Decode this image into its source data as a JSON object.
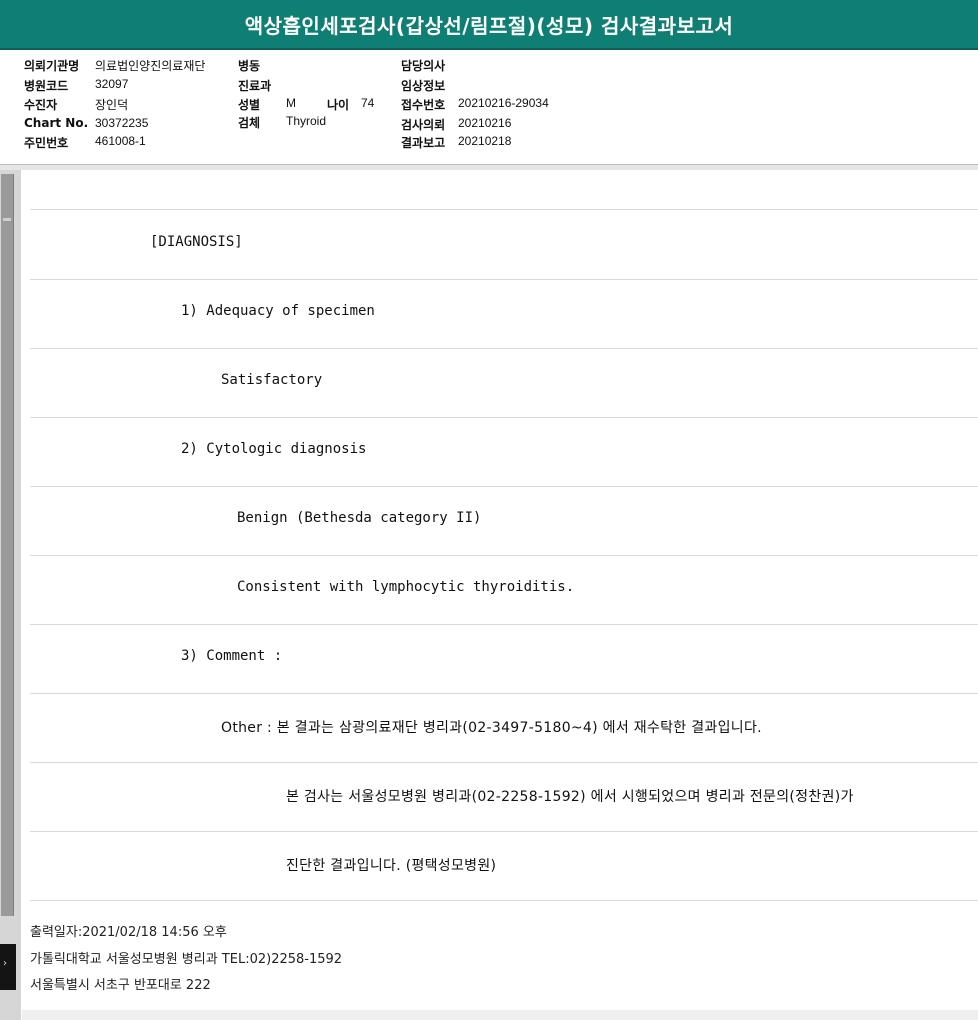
{
  "report": {
    "title": "액상흡인세포검사(갑상선/림프절)(성모) 검사결과보고서"
  },
  "header": {
    "institution_label": "의뢰기관명",
    "institution_value": "의료법인양진의료재단",
    "hospital_code_label": "병원코드",
    "hospital_code_value": "32097",
    "patient_label": "수진자",
    "patient_value": "장인덕",
    "chart_label": "Chart No.",
    "chart_value": "30372235",
    "id_label": "주민번호",
    "id_value": "461008-1",
    "ward_label": "병동",
    "ward_value": "",
    "dept_label": "진료과",
    "dept_value": "",
    "sex_label": "성별",
    "sex_value": "M",
    "age_label": "나이",
    "age_value": "74",
    "specimen_label": "검체",
    "specimen_value": "Thyroid",
    "doctor_label": "담당의사",
    "doctor_value": "",
    "clinical_label": "임상정보",
    "clinical_value": "",
    "receipt_label": "접수번호",
    "receipt_value": "20210216-29034",
    "request_label": "검사의뢰",
    "request_value": "20210216",
    "result_label": "결과보고",
    "result_value": "20210218"
  },
  "diagnosis_lines": [
    "",
    "[DIAGNOSIS]",
    "1) Adequacy of specimen",
    "Satisfactory",
    "2) Cytologic diagnosis",
    "Benign (Bethesda category II)",
    "Consistent with lymphocytic thyroiditis.",
    "3) Comment :",
    "Other : 본 결과는 삼광의료재단 병리과(02-3497-5180~4) 에서 재수탁한 결과입니다.",
    "본 검사는 서울성모병원 병리과(02-2258-1592) 에서 시행되었으며 병리과 전문의(정찬권)가",
    "진단한 결과입니다. (평택성모병원)"
  ],
  "footer": {
    "print_date": "출력일자:2021/02/18 14:56 오후",
    "lab": "가톨릭대학교 서울성모병원 병리과 TEL:02)2258-1592",
    "address": "서울특별시 서초구 반포대로 222"
  }
}
